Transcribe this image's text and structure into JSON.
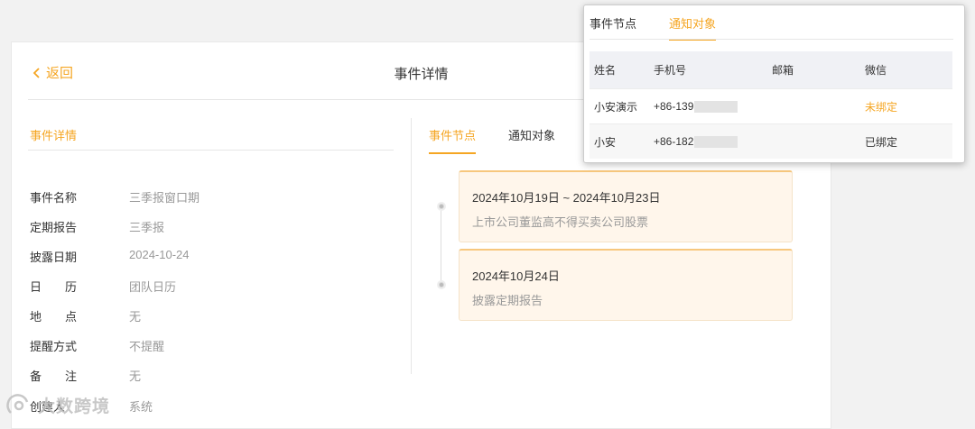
{
  "header": {
    "back_label": "返回",
    "page_title": "事件详情"
  },
  "detail": {
    "section_title": "事件详情",
    "fields": [
      {
        "label": "事件名称",
        "value": "三季报窗口期"
      },
      {
        "label": "定期报告",
        "value": "三季报"
      },
      {
        "label": "披露日期",
        "value": "2024-10-24"
      },
      {
        "label": "日　　历",
        "value": "团队日历"
      },
      {
        "label": "地　　点",
        "value": "无"
      },
      {
        "label": "提醒方式",
        "value": "不提醒"
      },
      {
        "label": "备　　注",
        "value": "无"
      },
      {
        "label": "创建人",
        "value": "系统"
      }
    ]
  },
  "timeline": {
    "tabs": [
      "事件节点",
      "通知对象"
    ],
    "active_tab": 0,
    "events": [
      {
        "date": "2024年10月19日 ~ 2024年10月23日",
        "desc": "上市公司董监高不得买卖公司股票"
      },
      {
        "date": "2024年10月24日",
        "desc": "披露定期报告"
      }
    ]
  },
  "popup": {
    "tabs": [
      "事件节点",
      "通知对象"
    ],
    "active_tab": 1,
    "columns": [
      "姓名",
      "手机号",
      "邮箱",
      "微信"
    ],
    "rows": [
      {
        "name": "小安演示",
        "phone": "+86-139",
        "email": "",
        "wechat": "未绑定",
        "wechat_status": "unbound"
      },
      {
        "name": "小安",
        "phone": "+86-182",
        "email": "",
        "wechat": "已绑定",
        "wechat_status": "bound"
      }
    ]
  },
  "watermark": {
    "text": "大数跨境"
  },
  "colors": {
    "accent": "#f5a623",
    "muted": "#999999",
    "event_bg": "#fff6eb"
  }
}
